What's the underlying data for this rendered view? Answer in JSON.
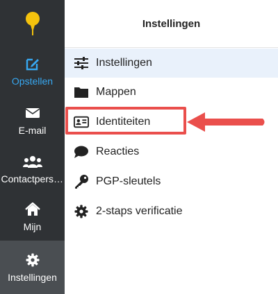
{
  "sidebar": {
    "items": [
      {
        "label": "Opstellen",
        "icon": "compose-icon"
      },
      {
        "label": "E-mail",
        "icon": "envelope-icon"
      },
      {
        "label": "Contactpersonen",
        "icon": "people-icon"
      },
      {
        "label": "Mijn",
        "icon": "home-icon"
      },
      {
        "label": "Instellingen",
        "icon": "gear-icon"
      }
    ]
  },
  "header": {
    "title": "Instellingen"
  },
  "menu": {
    "items": [
      {
        "label": "Instellingen",
        "icon": "sliders-icon"
      },
      {
        "label": "Mappen",
        "icon": "folder-icon"
      },
      {
        "label": "Identiteiten",
        "icon": "id-card-icon"
      },
      {
        "label": "Reacties",
        "icon": "speech-bubble-icon"
      },
      {
        "label": "PGP-sleutels",
        "icon": "key-icon"
      },
      {
        "label": "2-staps verificatie",
        "icon": "gear-icon"
      }
    ]
  },
  "colors": {
    "sidebar_bg": "#2f3235",
    "accent_blue": "#37a8f2",
    "logo_yellow": "#f4c20d",
    "annotation_red": "#ea4f4c",
    "active_row": "#e9f1fb"
  }
}
